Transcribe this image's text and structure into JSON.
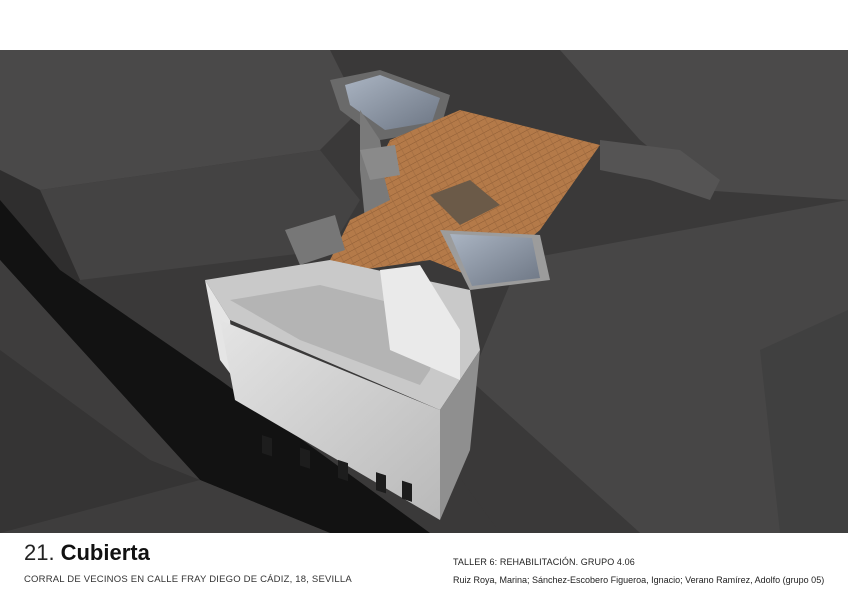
{
  "sheet": {
    "number": "21.",
    "title": "Cubierta",
    "subtitle": "CORRAL DE VECINOS EN CALLE FRAY DIEGO DE CÁDIZ, 18, SEVILLA"
  },
  "credits": {
    "course": "TALLER 6: REHABILITACIÓN. GRUPO 4.06",
    "authors": "Ruiz Roya, Marina; Sánchez-Escobero Figueroa, Ignacio; Verano Ramírez, Adolfo (grupo 05)"
  },
  "colors": {
    "background": "#ffffff",
    "neighbour_blocks": "#3c3b3b",
    "street": "#111111",
    "facade": "#d8d8d8",
    "roof_tiles": "#b47a49",
    "skylight": "#9aa5b4"
  }
}
